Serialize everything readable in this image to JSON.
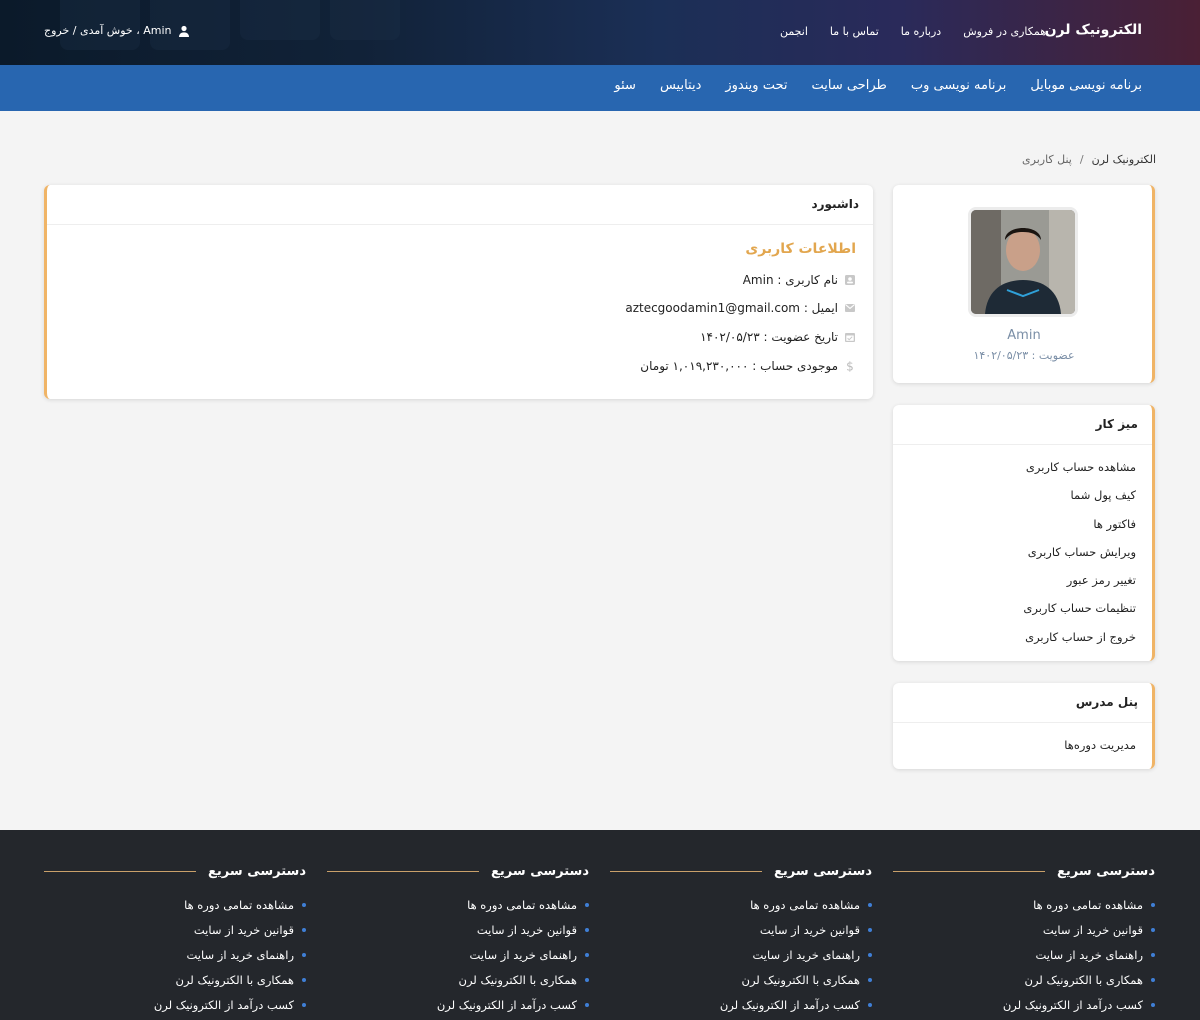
{
  "header": {
    "brand": "الکترونیک لرن",
    "nav": [
      "همکاری در فروش",
      "درباره ما",
      "تماس با ما",
      "انجمن"
    ],
    "welcome": "Amin ، خوش آمدی / خروج"
  },
  "categories": [
    "برنامه نویسی موبایل",
    "برنامه نویسی وب",
    "طراحی سایت",
    "تحت ویندوز",
    "دیتابیس",
    "سئو"
  ],
  "breadcrumb": {
    "home": "الکترونیک لرن",
    "sep": "/",
    "current": "پنل کاربری"
  },
  "profile": {
    "name": "Amin",
    "joined": "عضویت : ۱۴۰۲/۰۵/۲۳"
  },
  "dashboard": {
    "title": "داشبورد",
    "subtitle": "اطلاعات کاربری",
    "username": "نام کاربری : Amin",
    "email": "ایمیل : aztecgoodamin1@gmail.com",
    "joined": "تاریخ عضویت : ۱۴۰۲/۰۵/۲۳",
    "balance": "موجودی حساب : ۱,۰۱۹,۲۳۰,۰۰۰ تومان"
  },
  "desk": {
    "title": "میز کار",
    "items": [
      "مشاهده حساب کاربری",
      "کیف پول شما",
      "فاکتور ها",
      "ویرایش حساب کاربری",
      "تغییر رمز عبور",
      "تنظیمات حساب کاربری",
      "خروج از حساب کاربری"
    ]
  },
  "teacher": {
    "title": "پنل مدرس",
    "items": [
      "مدیریت دوره‌ها"
    ]
  },
  "footer": {
    "columns": [
      {
        "title": "دسترسی سریع",
        "links": [
          "مشاهده تمامی دوره ها",
          "قوانین خرید از سایت",
          "راهنمای خرید از سایت",
          "همکاری با الکترونیک لرن",
          "کسب درآمد از الکترونیک لرن"
        ]
      },
      {
        "title": "دسترسی سریع",
        "links": [
          "مشاهده تمامی دوره ها",
          "قوانین خرید از سایت",
          "راهنمای خرید از سایت",
          "همکاری با الکترونیک لرن",
          "کسب درآمد از الکترونیک لرن"
        ]
      },
      {
        "title": "دسترسی سریع",
        "links": [
          "مشاهده تمامی دوره ها",
          "قوانین خرید از سایت",
          "راهنمای خرید از سایت",
          "همکاری با الکترونیک لرن",
          "کسب درآمد از الکترونیک لرن"
        ]
      },
      {
        "title": "دسترسی سریع",
        "links": [
          "مشاهده تمامی دوره ها",
          "قوانین خرید از سایت",
          "راهنمای خرید از سایت",
          "همکاری با الکترونیک لرن",
          "کسب درآمد از الکترونیک لرن"
        ]
      }
    ]
  },
  "colors": {
    "accent": "#f0b466",
    "nav_blue": "#2866b0",
    "footer_bg": "#24272c",
    "subtitle": "#e2a64e"
  }
}
